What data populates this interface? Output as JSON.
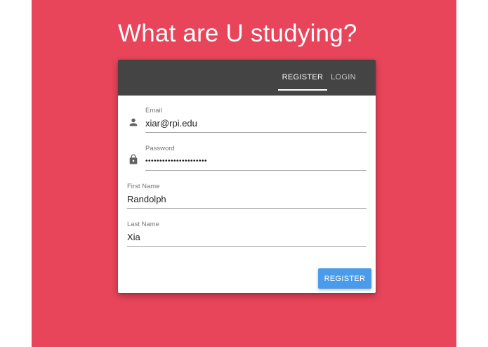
{
  "page": {
    "headline": "What are U studying?",
    "background_color": "#e8445a"
  },
  "tabs": [
    {
      "label": "REGISTER",
      "active": true
    },
    {
      "label": "LOGIN",
      "active": false
    }
  ],
  "form": {
    "email": {
      "label": "Email",
      "value": "xiar@rpi.edu",
      "icon": "person-icon"
    },
    "password": {
      "label": "Password",
      "value": "••••••••••••••••••••••",
      "icon": "lock-icon"
    },
    "first_name": {
      "label": "First Name",
      "value": "Randolph"
    },
    "last_name": {
      "label": "Last Name",
      "value": "Xia"
    },
    "submit_label": "REGISTER"
  },
  "colors": {
    "tab_bar": "#444444",
    "accent_button": "#4a9be9"
  }
}
